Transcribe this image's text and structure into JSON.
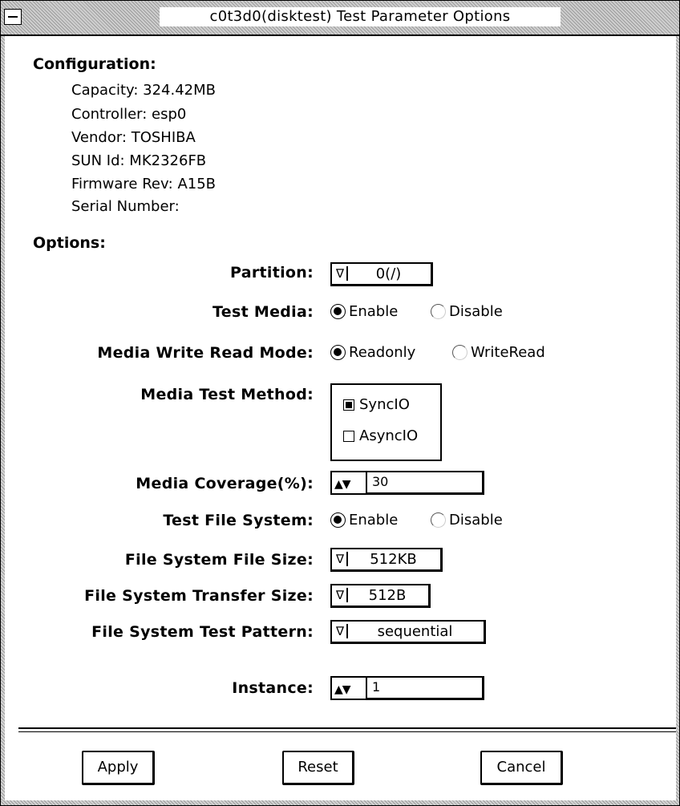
{
  "window": {
    "title": "c0t3d0(disktest) Test Parameter Options"
  },
  "configuration": {
    "heading": "Configuration:",
    "items": [
      "Capacity: 324.42MB",
      "Controller: esp0",
      "Vendor: TOSHIBA",
      "SUN Id: MK2326FB",
      "Firmware Rev: A15B",
      "Serial Number:"
    ]
  },
  "options": {
    "heading": "Options:",
    "partition": {
      "label": "Partition:",
      "value": "0(/)",
      "arrow": "∇"
    },
    "test_media": {
      "label": "Test Media:",
      "enable": "Enable",
      "disable": "Disable",
      "selected": "Enable"
    },
    "write_read_mode": {
      "label": "Media Write Read Mode:",
      "readonly": "Readonly",
      "writeread": "WriteRead",
      "selected": "Readonly"
    },
    "test_method": {
      "label": "Media Test Method:",
      "sync": "SyncIO",
      "async": "AsyncIO",
      "sync_checked": true,
      "async_checked": false
    },
    "coverage": {
      "label": "Media Coverage(%):",
      "value": "30",
      "arrows": "▲▼"
    },
    "test_fs": {
      "label": "Test File System:",
      "enable": "Enable",
      "disable": "Disable",
      "selected": "Enable"
    },
    "fs_file_size": {
      "label": "File System File Size:",
      "value": "512KB",
      "arrow": "∇"
    },
    "fs_transfer_size": {
      "label": "File System Transfer Size:",
      "value": "512B",
      "arrow": "∇"
    },
    "fs_test_pattern": {
      "label": "File System Test Pattern:",
      "value": "sequential",
      "arrow": "∇"
    },
    "instance": {
      "label": "Instance:",
      "value": "1",
      "arrows": "▲▼"
    }
  },
  "buttons": {
    "apply": "Apply",
    "reset": "Reset",
    "cancel": "Cancel"
  }
}
